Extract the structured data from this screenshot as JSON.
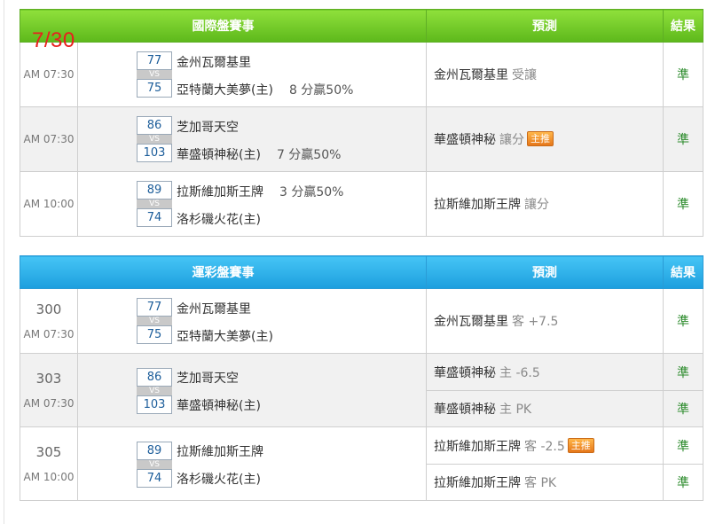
{
  "date_label": "7/30",
  "intl": {
    "header": {
      "title": "國際盤賽事",
      "pred": "預測",
      "res": "結果"
    },
    "games": [
      {
        "time": "AM 07:30",
        "score1": "77",
        "score2": "75",
        "team1": "金州瓦爾基里",
        "team2": "亞特蘭大美夢(主)",
        "note1": "",
        "note2": "8 分贏50%",
        "pred_team": "金州瓦爾基里",
        "pred_type": "受讓",
        "badge": "",
        "result": "準"
      },
      {
        "time": "AM 07:30",
        "score1": "86",
        "score2": "103",
        "team1": "芝加哥天空",
        "team2": "華盛頓神秘(主)",
        "note1": "",
        "note2": "7 分贏50%",
        "pred_team": "華盛頓神秘",
        "pred_type": "讓分",
        "badge": "主推",
        "result": "準"
      },
      {
        "time": "AM 10:00",
        "score1": "89",
        "score2": "74",
        "team1": "拉斯維加斯王牌",
        "team2": "洛杉磯火花(主)",
        "note1": "3 分贏50%",
        "note2": "",
        "pred_team": "拉斯維加斯王牌",
        "pred_type": "讓分",
        "badge": "",
        "result": "準"
      }
    ]
  },
  "lottery": {
    "header": {
      "title": "運彩盤賽事",
      "pred": "預測",
      "res": "結果"
    },
    "games": [
      {
        "num": "300",
        "time": "AM 07:30",
        "score1": "77",
        "score2": "75",
        "team1": "金州瓦爾基里",
        "team2": "亞特蘭大美夢(主)",
        "preds": [
          {
            "team": "金州瓦爾基里",
            "type": "客 +7.5",
            "badge": "",
            "result": "準"
          }
        ]
      },
      {
        "num": "303",
        "time": "AM 07:30",
        "score1": "86",
        "score2": "103",
        "team1": "芝加哥天空",
        "team2": "華盛頓神秘(主)",
        "preds": [
          {
            "team": "華盛頓神秘",
            "type": "主 -6.5",
            "badge": "",
            "result": "準"
          },
          {
            "team": "華盛頓神秘",
            "type": "主 PK",
            "badge": "",
            "result": "準"
          }
        ]
      },
      {
        "num": "305",
        "time": "AM 10:00",
        "score1": "89",
        "score2": "74",
        "team1": "拉斯維加斯王牌",
        "team2": "洛杉磯火花(主)",
        "preds": [
          {
            "team": "拉斯維加斯王牌",
            "type": "客 -2.5",
            "badge": "主推",
            "result": "準"
          },
          {
            "team": "拉斯維加斯王牌",
            "type": "客 PK",
            "badge": "",
            "result": "準"
          }
        ]
      }
    ]
  }
}
